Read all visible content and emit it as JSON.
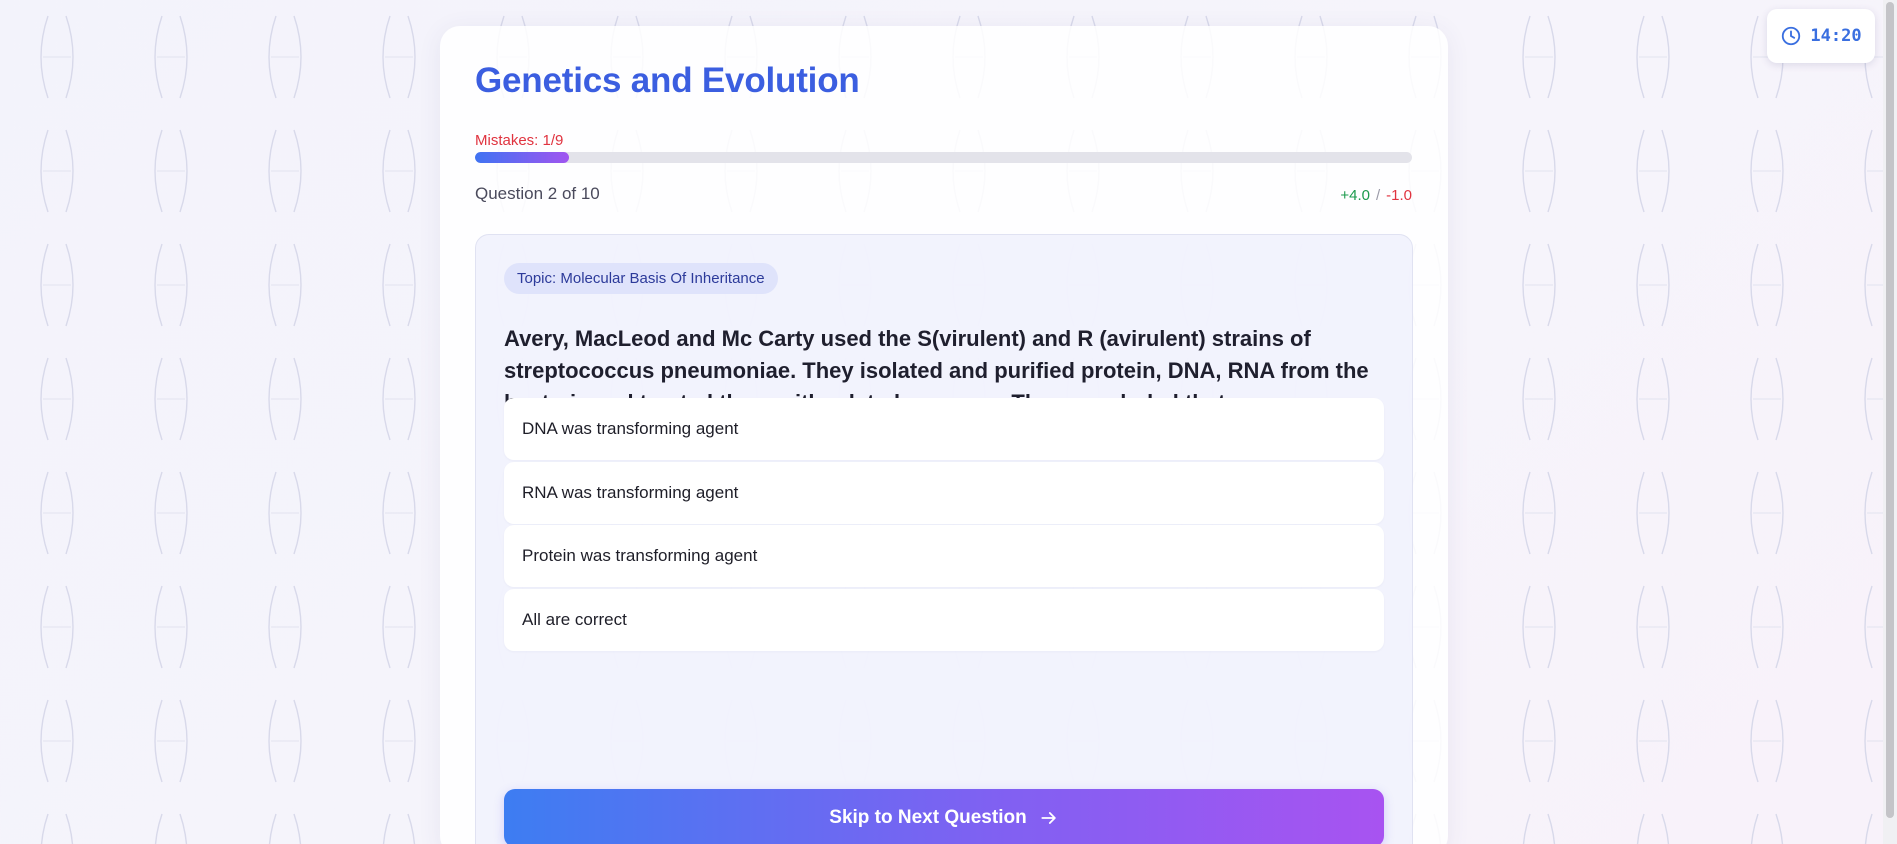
{
  "timer": {
    "value": "14:20",
    "icon": "clock-icon"
  },
  "quiz": {
    "title": "Genetics and Evolution",
    "mistakes_label": "Mistakes: 1/9",
    "progress_fraction": 0.1,
    "question_counter": "Question 2 of 10",
    "scoring": {
      "positive": "+4.0",
      "separator": "/",
      "negative": "-1.0"
    },
    "topic": "Topic: Molecular Basis Of Inheritance",
    "question_text": "Avery, MacLeod and Mc Carty used the S(virulent) and R (avirulent) strains of streptococcus pneumoniae. They isolated and purified protein, DNA, RNA from the bacteria and treated them with related enzymes. They concluded that :",
    "options": [
      "DNA was transforming agent",
      "RNA was transforming agent",
      "Protein was transforming agent",
      "All are correct"
    ],
    "skip_button": {
      "label": "Skip to Next Question",
      "icon": "arrow-right-icon"
    }
  },
  "colors": {
    "title": "#3b5ee0",
    "mistakes": "#e0333f",
    "positive": "#1b9a4c",
    "negative": "#e0333f",
    "gradient_start": "#3d7df2",
    "gradient_end": "#a853f1"
  }
}
